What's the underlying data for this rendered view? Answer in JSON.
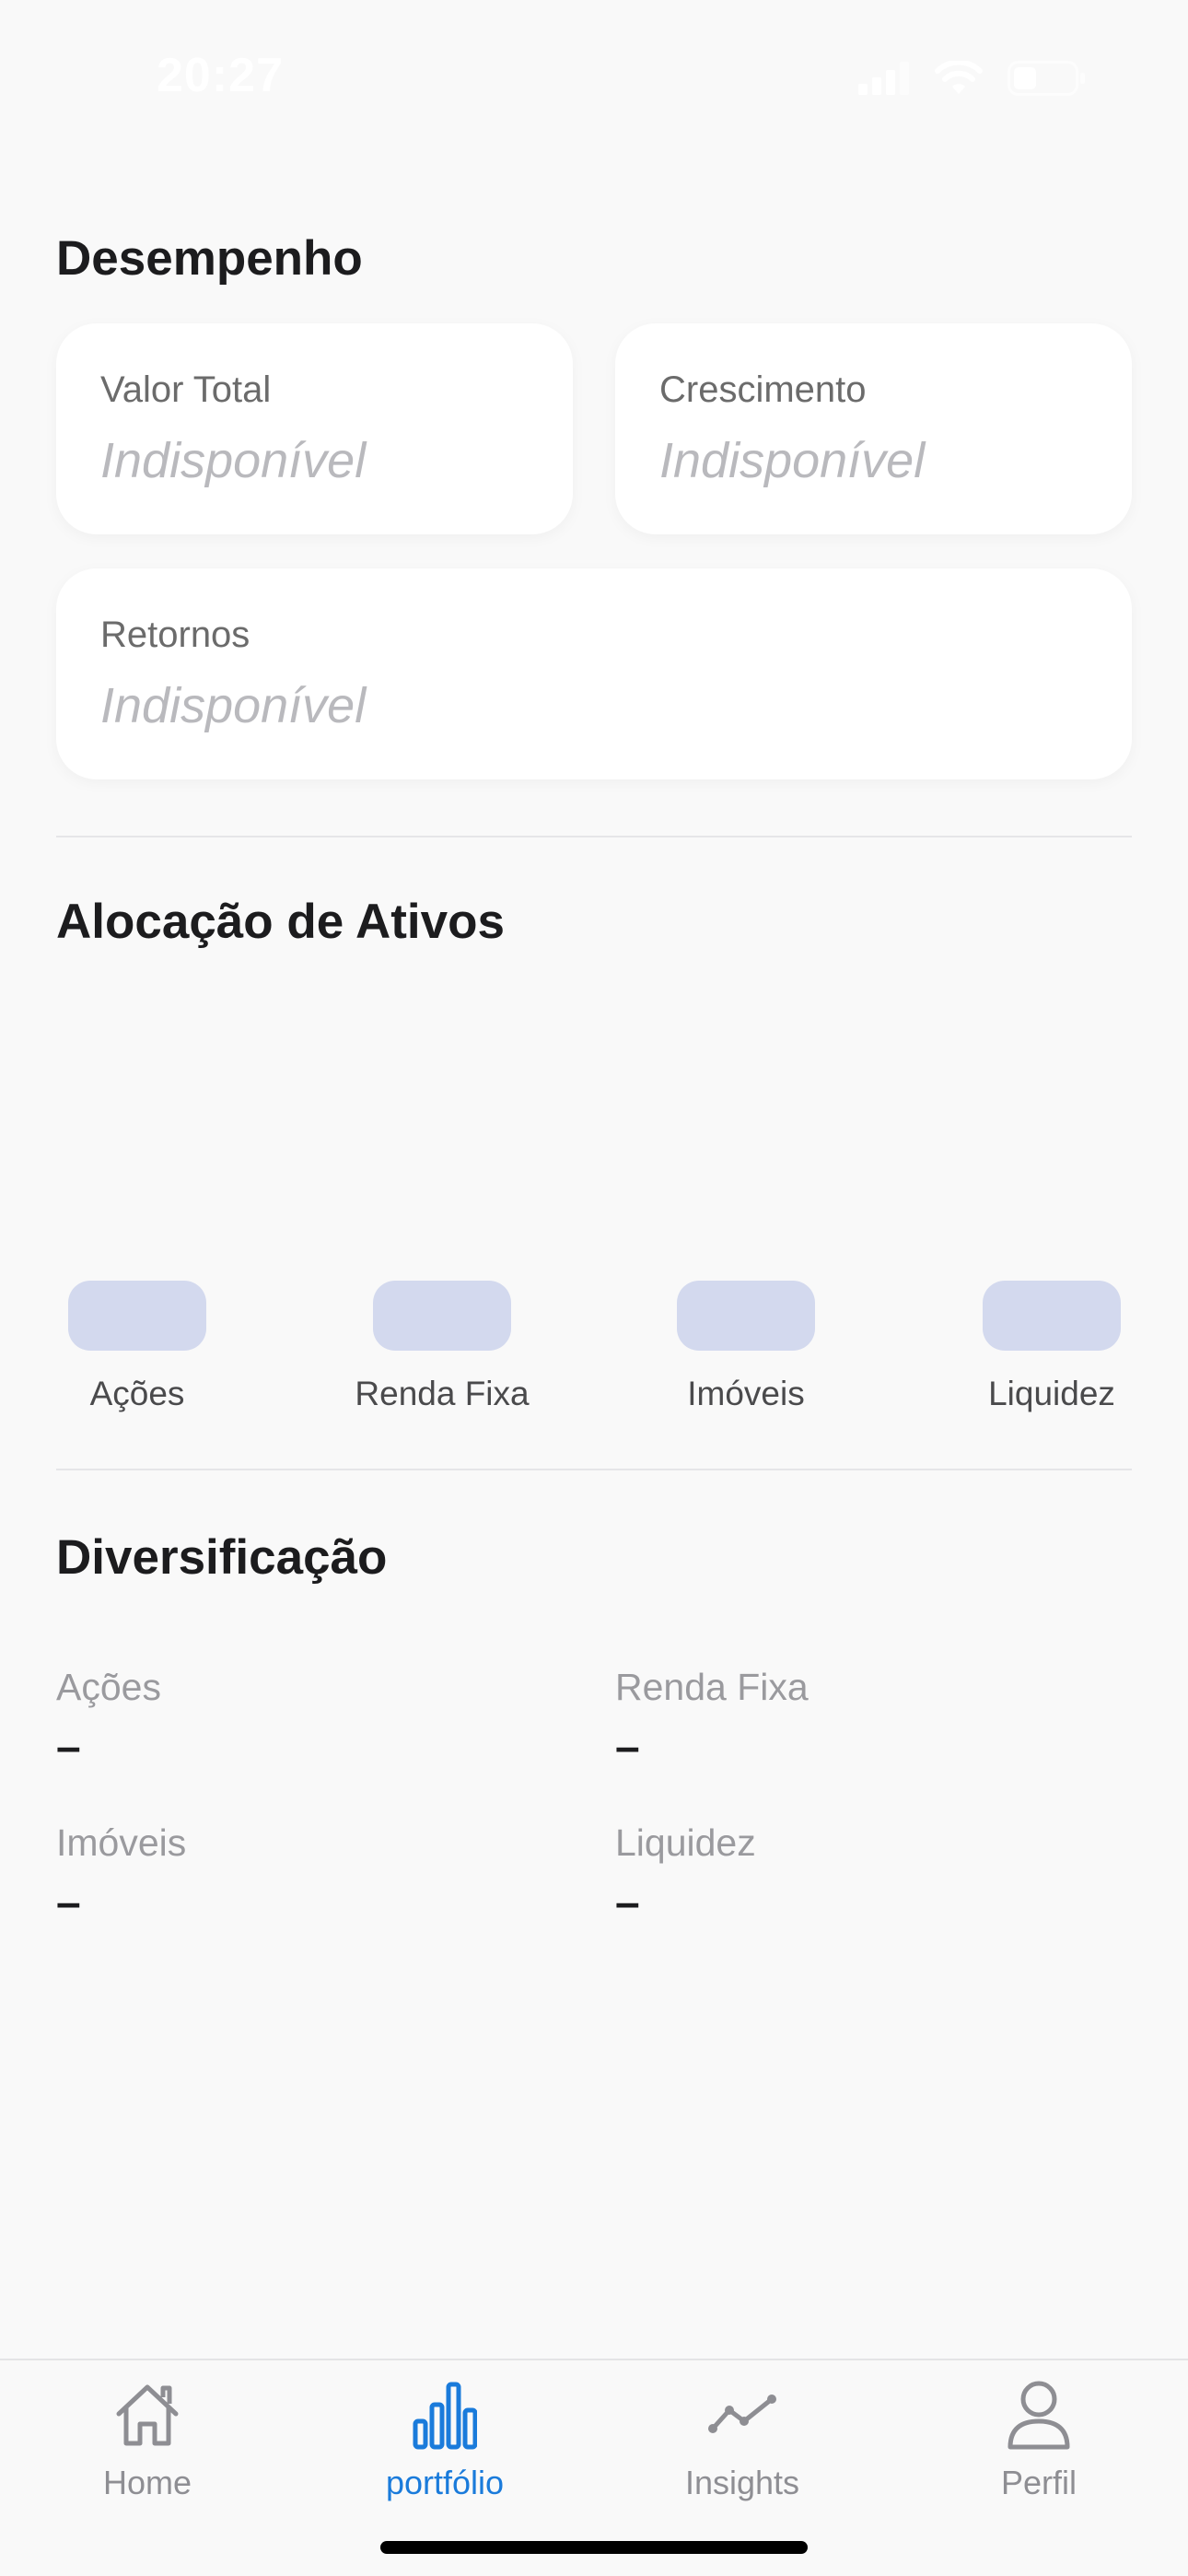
{
  "status_bar": {
    "time": "20:27"
  },
  "performance": {
    "title": "Desempenho",
    "cards": [
      {
        "label": "Valor Total",
        "value": "Indisponível"
      },
      {
        "label": "Crescimento",
        "value": "Indisponível"
      },
      {
        "label": "Retornos",
        "value": "Indisponível"
      }
    ]
  },
  "allocation": {
    "title": "Alocação de Ativos",
    "items": [
      {
        "label": "Ações"
      },
      {
        "label": "Renda Fixa"
      },
      {
        "label": "Imóveis"
      },
      {
        "label": "Liquidez"
      }
    ],
    "chip_color": "#d3d9ee"
  },
  "diversification": {
    "title": "Diversificação",
    "items": [
      {
        "label": "Ações",
        "value": "–"
      },
      {
        "label": "Renda Fixa",
        "value": "–"
      },
      {
        "label": "Imóveis",
        "value": "–"
      },
      {
        "label": "Liquidez",
        "value": "–"
      }
    ]
  },
  "tab_bar": {
    "tabs": [
      {
        "label": "Home",
        "icon": "house-icon"
      },
      {
        "label": "portfólio",
        "icon": "bar-chart-icon",
        "active": true
      },
      {
        "label": "Insights",
        "icon": "trend-line-icon"
      },
      {
        "label": "Perfil",
        "icon": "person-icon"
      }
    ],
    "active_color": "#1a7bdb",
    "inactive_color": "#8e8e93"
  }
}
